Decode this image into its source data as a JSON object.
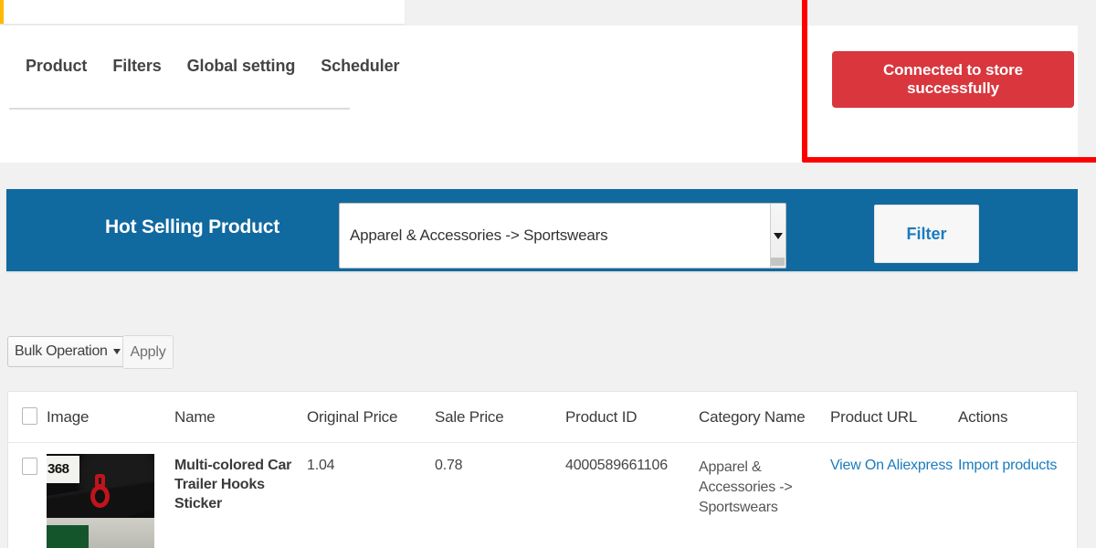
{
  "notice": {
    "accent_color": "#ffb900"
  },
  "header": {
    "tabs": [
      {
        "label": "Product"
      },
      {
        "label": "Filters"
      },
      {
        "label": "Global setting"
      },
      {
        "label": "Scheduler"
      }
    ],
    "store_status_button": {
      "label": "Connected to store successfully",
      "color": "#d9363e"
    }
  },
  "annotation": {
    "highlight_color": "#ff0000"
  },
  "filter_bar": {
    "title": "Hot Selling Product",
    "background_color": "#10699f",
    "category_select": {
      "value": "Apparel & Accessories -> Sportswears"
    },
    "filter_button": {
      "label": "Filter",
      "color": "#1a7bbd"
    }
  },
  "bulk": {
    "select_label": "Bulk Operation",
    "apply_label": "Apply"
  },
  "table": {
    "columns": [
      "Image",
      "Name",
      "Original Price",
      "Sale Price",
      "Product ID",
      "Category Name",
      "Product URL",
      "Actions"
    ],
    "rows": [
      {
        "image_alt": "Multi-colored car trailer hook sticker on vehicle bumper",
        "image_plate_text": "368",
        "name": "Multi-colored Car Trailer Hooks Sticker",
        "original_price": "1.04",
        "sale_price": "0.78",
        "product_id": "4000589661106",
        "category_name": "Apparel & Accessories -> Sportswears",
        "product_url_label": "View On Aliexpress",
        "action_label": "Import products"
      }
    ]
  }
}
